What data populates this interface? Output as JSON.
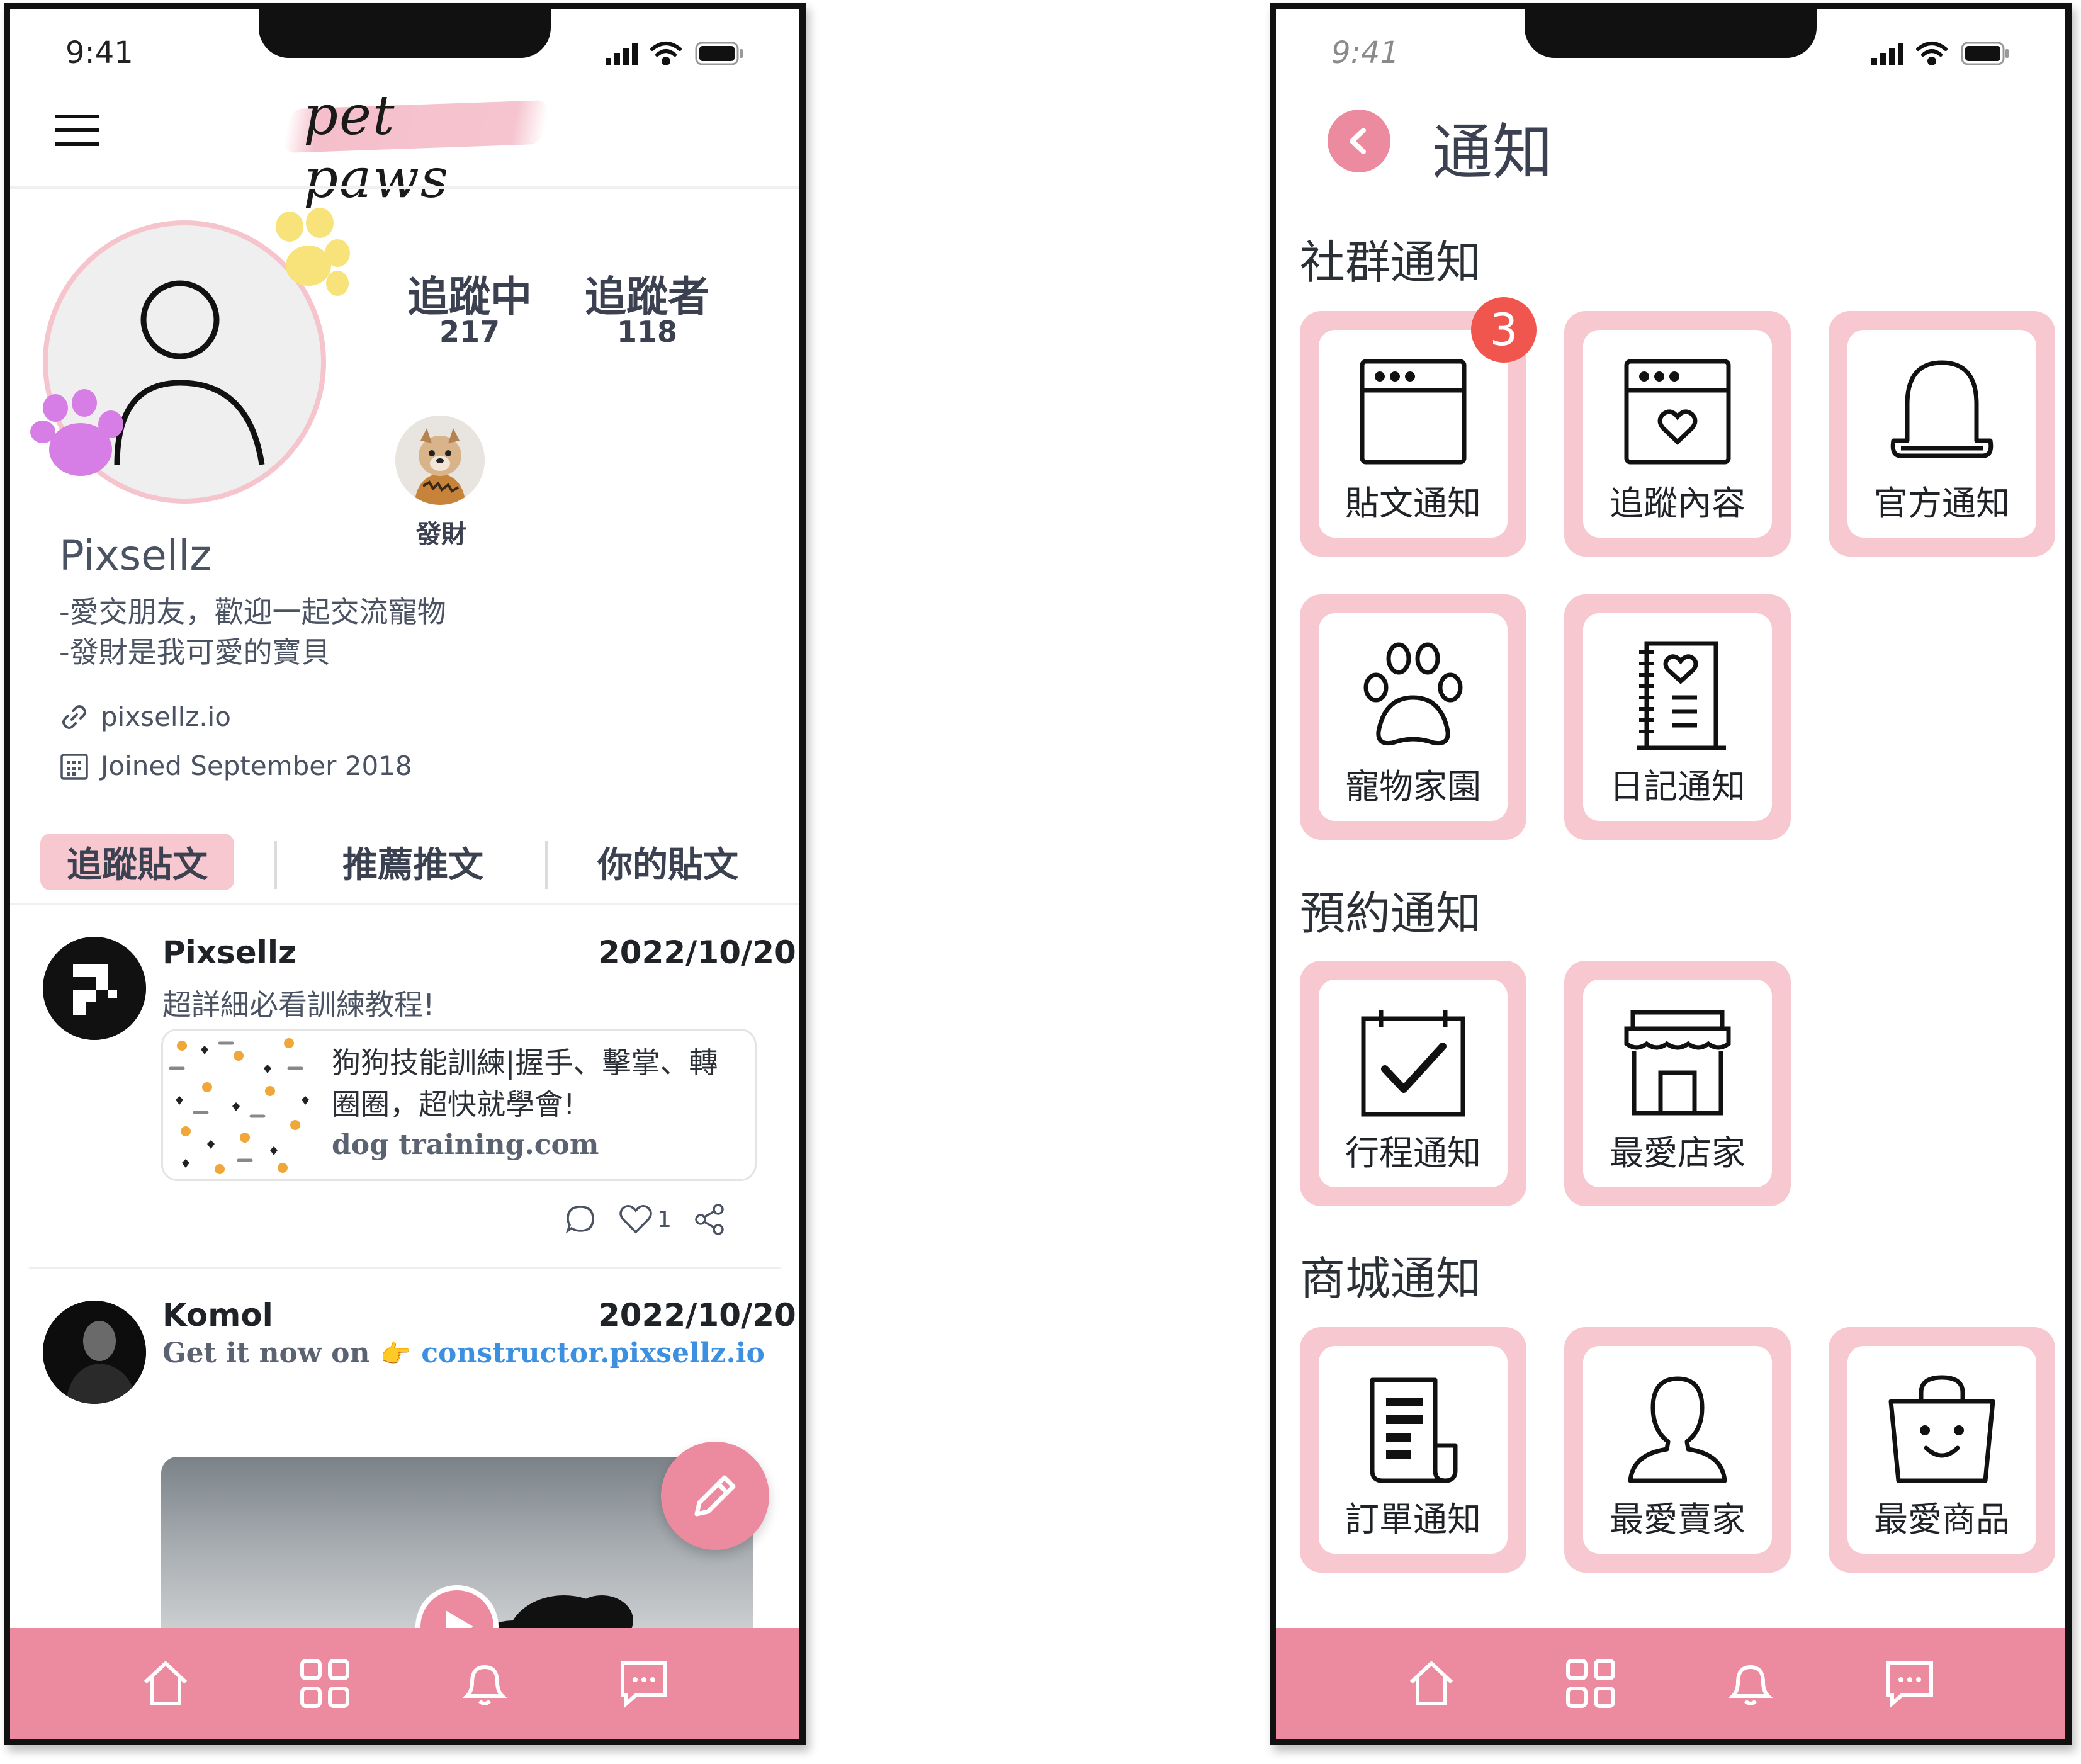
{
  "left_screen": {
    "status": {
      "time": "9:41"
    },
    "logo": "pet paws",
    "profile": {
      "name": "Pixsellz",
      "bio": [
        "-愛交朋友，歡迎一起交流寵物",
        "-發財是我可愛的寶貝"
      ],
      "website": "pixsellz.io",
      "joined": "Joined September 2018",
      "following_label": "追蹤中",
      "following_count": "217",
      "followers_label": "追蹤者",
      "followers_count": "118",
      "pet_name": "發財"
    },
    "feed_tabs": [
      "追蹤貼文",
      "推薦推文",
      "你的貼文"
    ],
    "posts": [
      {
        "author": "Pixsellz",
        "date": "2022/10/20",
        "text": "超詳細必看訓練教程!",
        "link_title": "狗狗技能訓練|握手、擊掌、轉圈圈，超快就學會!",
        "link_domain": "dog training.com",
        "likes": "1"
      },
      {
        "author": "Komol",
        "date": "2022/10/20",
        "promo_text": "Get it now on",
        "promo_emoji": "👉",
        "promo_link": "constructor.pixsellz.io"
      }
    ]
  },
  "right_screen": {
    "status": {
      "time": "9:41"
    },
    "title": "通知",
    "sections": [
      {
        "title": "社群通知",
        "items": [
          {
            "label": "貼文通知",
            "icon": "browser-window-icon",
            "badge": "3"
          },
          {
            "label": "追蹤內容",
            "icon": "browser-heart-icon"
          },
          {
            "label": "官方通知",
            "icon": "bell-icon"
          },
          {
            "label": "寵物家園",
            "icon": "paw-icon"
          },
          {
            "label": "日記通知",
            "icon": "diary-icon"
          }
        ]
      },
      {
        "title": "預約通知",
        "items": [
          {
            "label": "行程通知",
            "icon": "calendar-check-icon"
          },
          {
            "label": "最愛店家",
            "icon": "store-icon"
          }
        ]
      },
      {
        "title": "商城通知",
        "items": [
          {
            "label": "訂單通知",
            "icon": "receipt-icon"
          },
          {
            "label": "最愛賣家",
            "icon": "user-icon"
          },
          {
            "label": "最愛商品",
            "icon": "shopping-bag-icon"
          }
        ]
      }
    ]
  },
  "tabbar_icons": [
    "home-icon",
    "grid-icon",
    "bell-icon",
    "chat-icon"
  ],
  "colors": {
    "accent_pink": "#ec8aa0",
    "tile_pink": "#f7c8cf",
    "badge_red": "#f0554e",
    "link_blue": "#3d8fe0"
  }
}
